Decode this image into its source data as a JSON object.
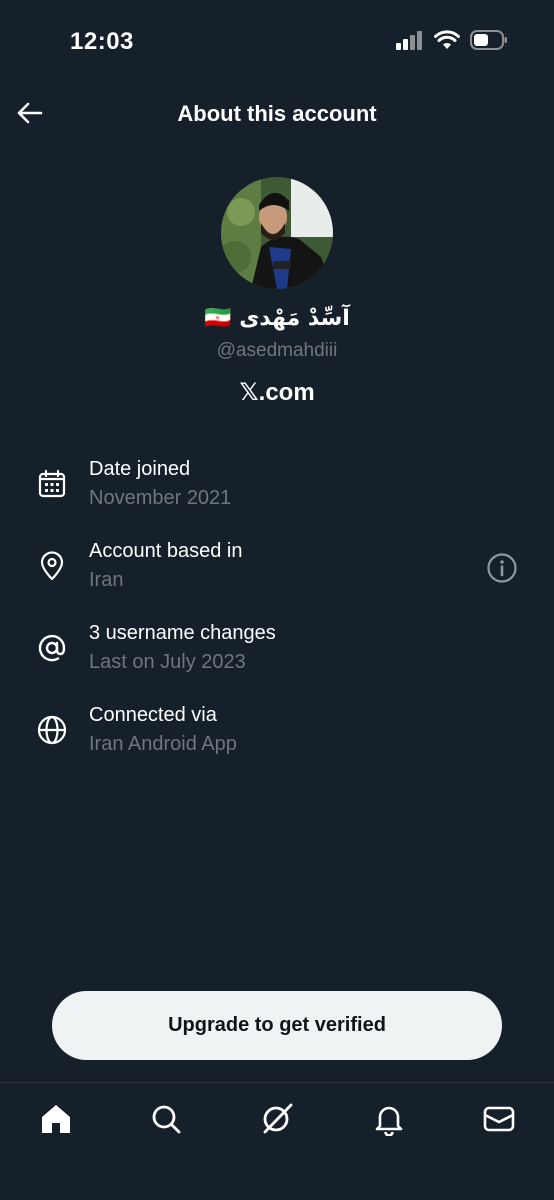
{
  "status_bar": {
    "time": "12:03",
    "icons": [
      "cellular-signal-icon",
      "wifi-icon",
      "battery-icon"
    ]
  },
  "header": {
    "back_icon": "arrow-left-icon",
    "title": "About this account"
  },
  "profile": {
    "display_name": "آسِّدْ مَهْدی",
    "flag": "🇮🇷",
    "handle": "@asedmahdiii",
    "site_prefix": "𝕏",
    "site_suffix": ".com"
  },
  "info_items": [
    {
      "icon": "calendar-icon",
      "title": "Date joined",
      "subtitle": "November 2021"
    },
    {
      "icon": "location-pin-icon",
      "title": "Account based in",
      "subtitle": "Iran",
      "action_icon": "info-circle-icon"
    },
    {
      "icon": "at-sign-icon",
      "title": "3 username changes",
      "subtitle": "Last on July 2023"
    },
    {
      "icon": "globe-icon",
      "title": "Connected via",
      "subtitle": "Iran Android App"
    }
  ],
  "upgrade_button": {
    "label": "Upgrade to get verified"
  },
  "tabbar": {
    "tabs": [
      "home-icon",
      "search-icon",
      "grok-icon",
      "bell-icon",
      "mail-icon"
    ]
  },
  "colors": {
    "background": "#15202b",
    "primary_text": "#ffffff",
    "secondary_text": "#71767b",
    "button_bg": "#eff3f4"
  }
}
